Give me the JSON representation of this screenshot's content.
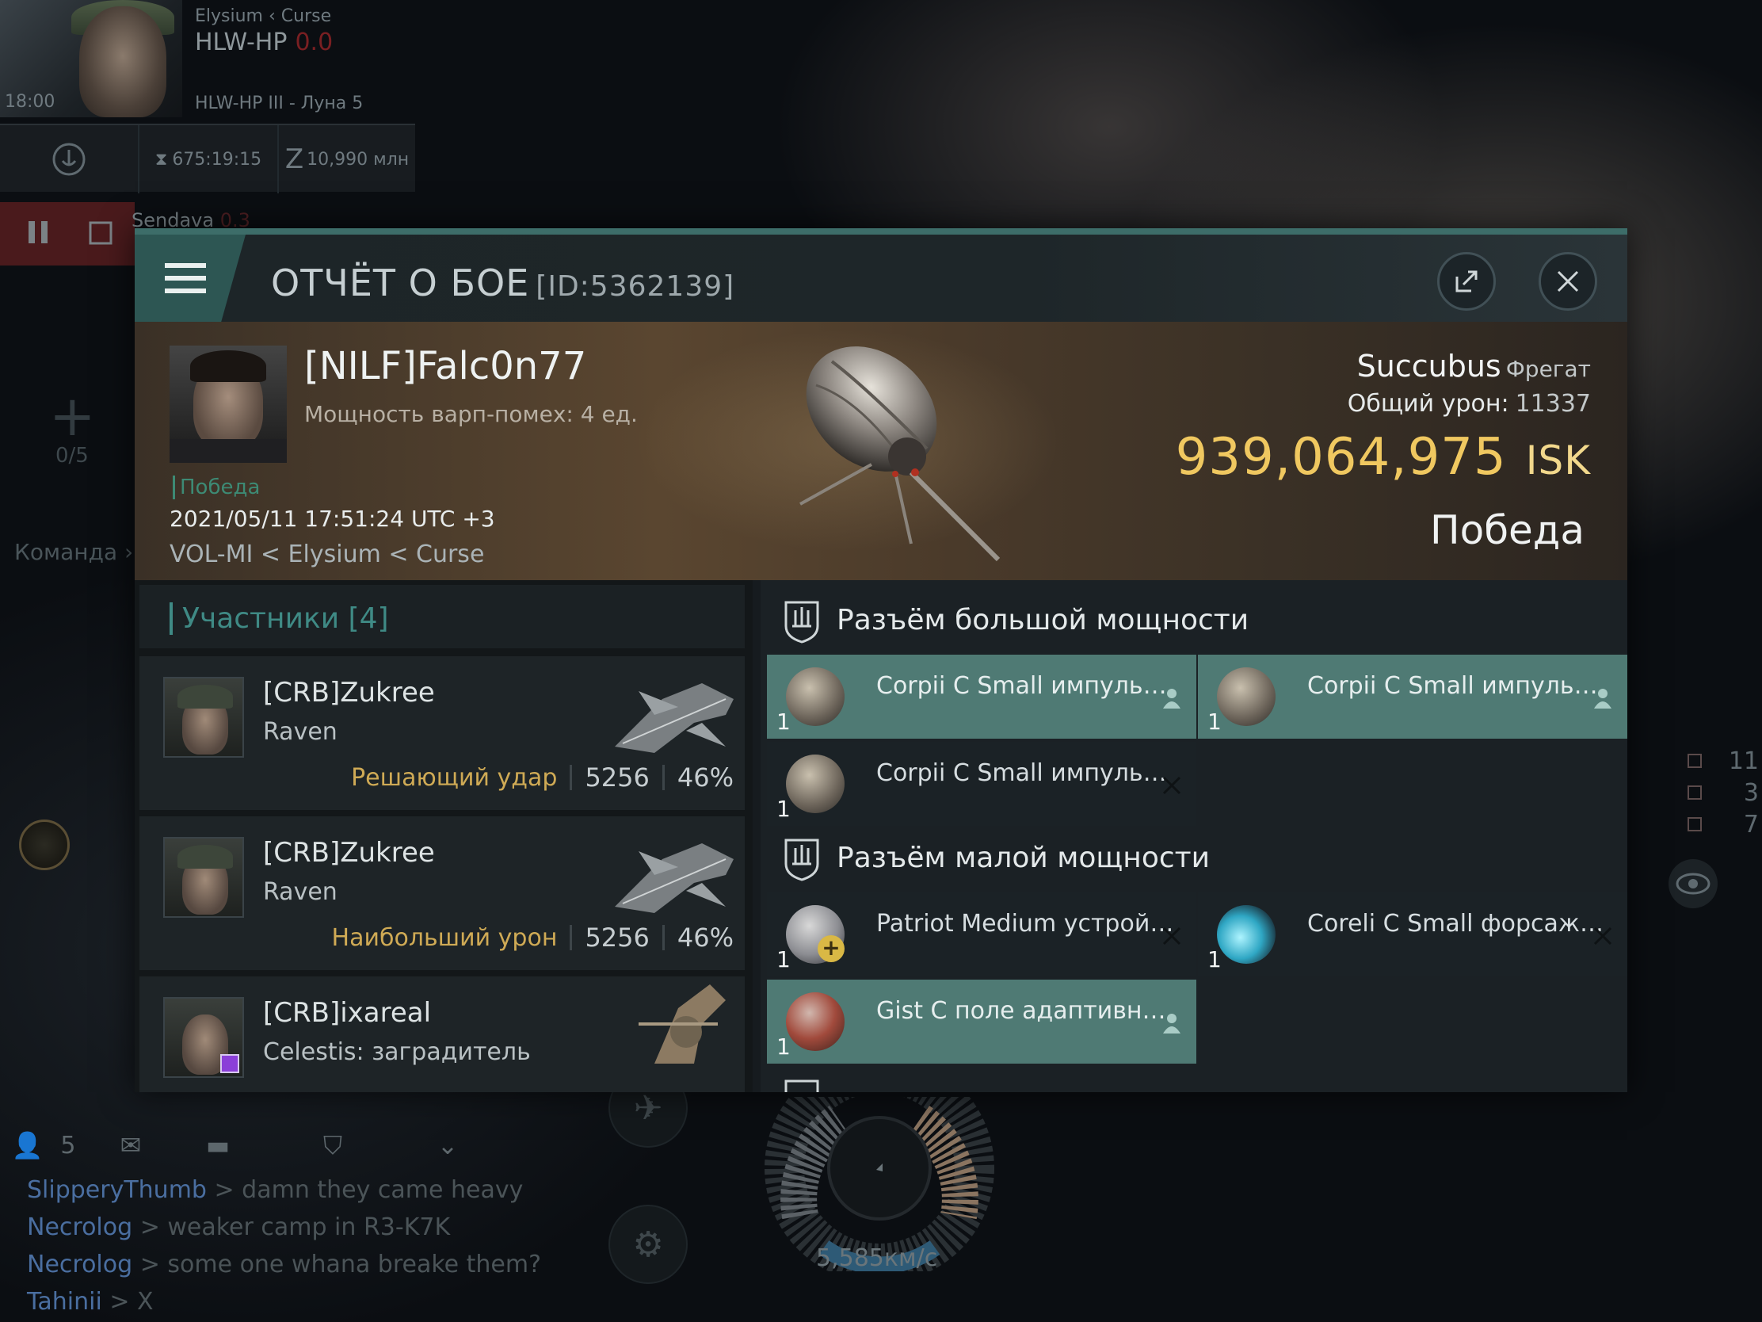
{
  "hud": {
    "region_path": "Elysium  ‹ Curse",
    "system": "HLW-HP",
    "security": "0.0",
    "location": "HLW-HP III - Луна 5",
    "time": "18:00",
    "timer": "675:19:15",
    "wallet": "10,990 млн",
    "target_name": "Sendava",
    "target_sec": "0.3",
    "team_slots": "0/5",
    "team_label": "Команда"
  },
  "report": {
    "title": "ОТЧЁТ О БОЕ",
    "id_label": "[ID:5362139]",
    "victim": {
      "name": "[NILF]Falc0n77",
      "warp_scramble": "Мощность варп-помех: 4 ед.",
      "result_tag": "Победа",
      "datetime": "2021/05/11 17:51:24 UTC +3",
      "location": "VOL-MI < Elysium < Curse"
    },
    "ship": {
      "name": "Succubus",
      "class": "Фрегат",
      "damage_label": "Общий урон:",
      "damage_value": "11337",
      "isk_value": "939,064,975",
      "isk_unit": "ISK",
      "result": "Победа"
    },
    "participants": {
      "header": "Участники [4]",
      "rows": [
        {
          "name": "[CRB]Zukree",
          "ship": "Raven",
          "tag": "Решающий удар",
          "damage": "5256",
          "percent": "46%"
        },
        {
          "name": "[CRB]Zukree",
          "ship": "Raven",
          "tag": "Наибольший урон",
          "damage": "5256",
          "percent": "46%"
        },
        {
          "name": "[CRB]ixareal",
          "ship": "Celestis: заградитель",
          "tag": "",
          "damage": "",
          "percent": ""
        }
      ]
    },
    "high_slots": {
      "label": "Разъём большой мощности",
      "modules": [
        {
          "name": "Corpii C Small импульсный...",
          "qty": "1",
          "status": "person"
        },
        {
          "name": "Corpii C Small импульсный...",
          "qty": "1",
          "status": "person"
        },
        {
          "name": "Corpii C Small импульсный...",
          "qty": "1",
          "status": "destroyed"
        }
      ]
    },
    "mid_slots": {
      "label": "Разъём малой мощности",
      "modules": [
        {
          "name": "Patriot Medium устройство ...",
          "qty": "1",
          "status": "destroyed"
        },
        {
          "name": "Coreli C Small форсажный...",
          "qty": "1",
          "status": "destroyed"
        },
        {
          "name": "Gist C поле адаптивной...",
          "qty": "1",
          "status": "person"
        }
      ]
    }
  },
  "right_stats": [
    {
      "icon": "target-icon",
      "value": "11"
    },
    {
      "icon": "drone-icon",
      "value": "3"
    },
    {
      "icon": "module-icon",
      "value": "7"
    }
  ],
  "chat": {
    "member_count": "5",
    "lines": [
      {
        "who": "SlipperyThumb",
        "msg": " > damn they came heavy"
      },
      {
        "who": "Necrolog",
        "msg": " > weaker camp in R3-K7K"
      },
      {
        "who": "Necrolog",
        "msg": " > some one whana breake them?"
      },
      {
        "who": "Tahinii",
        "msg": " > X"
      }
    ]
  },
  "speed": "5,585км/с",
  "colors": {
    "accent": "#3d6d69",
    "isk": "#f0c860",
    "tag_gold": "#cfaa55",
    "active_module": "#4f7a74",
    "chat_name": "#4a6ea0"
  }
}
